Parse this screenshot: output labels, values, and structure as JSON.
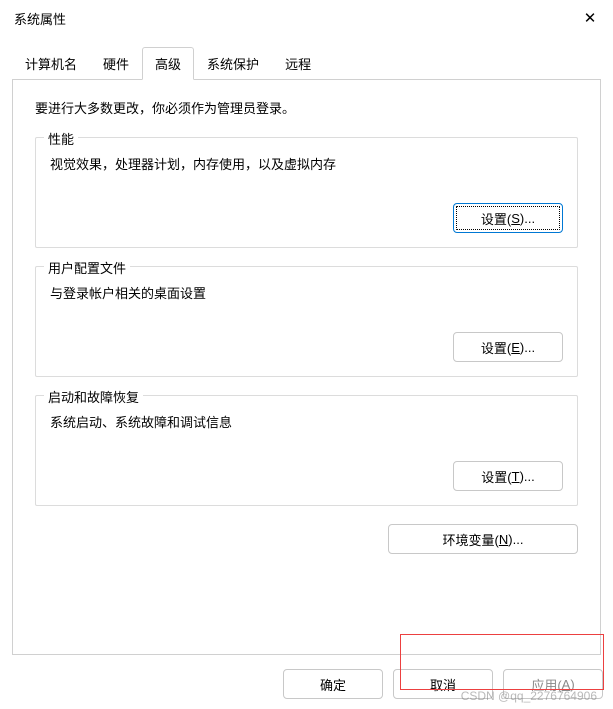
{
  "window": {
    "title": "系统属性"
  },
  "tabs": [
    {
      "label": "计算机名"
    },
    {
      "label": "硬件"
    },
    {
      "label": "高级"
    },
    {
      "label": "系统保护"
    },
    {
      "label": "远程"
    }
  ],
  "intro": "要进行大多数更改，你必须作为管理员登录。",
  "sections": {
    "performance": {
      "legend": "性能",
      "desc": "视觉效果，处理器计划，内存使用，以及虚拟内存",
      "button_prefix": "设置(",
      "button_hotkey": "S",
      "button_suffix": ")..."
    },
    "profiles": {
      "legend": "用户配置文件",
      "desc": "与登录帐户相关的桌面设置",
      "button_prefix": "设置(",
      "button_hotkey": "E",
      "button_suffix": ")..."
    },
    "startup": {
      "legend": "启动和故障恢复",
      "desc": "系统启动、系统故障和调试信息",
      "button_prefix": "设置(",
      "button_hotkey": "T",
      "button_suffix": ")..."
    }
  },
  "env_button": {
    "prefix": "环境变量(",
    "hotkey": "N",
    "suffix": ")..."
  },
  "footer": {
    "ok": "确定",
    "cancel": "取消",
    "apply_prefix": "应用(",
    "apply_hotkey": "A",
    "apply_suffix": ")"
  },
  "watermark": "CSDN @qq_2276764906"
}
